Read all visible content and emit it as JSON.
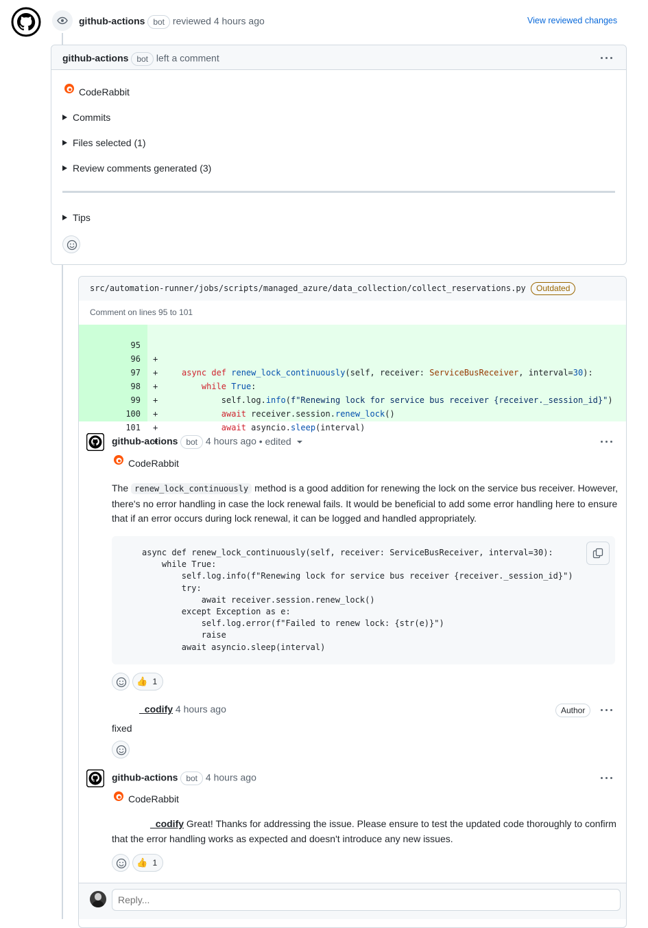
{
  "review": {
    "author": "github-actions",
    "bot_badge": "bot",
    "action": "reviewed 4 hours ago",
    "view_changes_link": "View reviewed changes"
  },
  "comment_box": {
    "author": "github-actions",
    "bot_badge": "bot",
    "action": "left a comment",
    "app_name": "CodeRabbit",
    "details": [
      {
        "label": "Commits"
      },
      {
        "label": "Files selected (1)"
      },
      {
        "label": "Review comments generated (3)"
      }
    ],
    "tips_label": "Tips"
  },
  "file_thread": {
    "path": "src/automation-runner/jobs/scripts/managed_azure/data_collection/collect_reservations.py",
    "outdated_badge": "Outdated",
    "comment_lines": "Comment on lines 95 to 101",
    "diff_lines": [
      {
        "num": "95",
        "sign": "+"
      },
      {
        "num": "96",
        "sign": "+"
      },
      {
        "num": "97",
        "sign": "+"
      },
      {
        "num": "98",
        "sign": "+"
      },
      {
        "num": "99",
        "sign": "+"
      },
      {
        "num": "100",
        "sign": "+"
      },
      {
        "num": "101",
        "sign": "+"
      }
    ],
    "diff_code": {
      "l95_kw1": "async def ",
      "l95_fn": "renew_lock_continuously",
      "l95_a": "(self, receiver: ",
      "l95_ty": "ServiceBusReceiver",
      "l95_b": ", interval=",
      "l95_num": "30",
      "l95_c": "):",
      "l96_kw": "while ",
      "l96_true": "True",
      "l96_c": ":",
      "l97_a": "self.log.",
      "l97_fn": "info",
      "l97_b": "(",
      "l97_st": "f\"Renewing lock for service bus receiver {receiver._session_id}\"",
      "l97_c": ")",
      "l98_kw": "await ",
      "l98_a": "receiver.session.",
      "l98_fn": "renew_lock",
      "l98_c": "()",
      "l99_kw": "await ",
      "l99_a": "asyncio.",
      "l99_fn": "sleep",
      "l99_c": "(interval)"
    }
  },
  "thread_comments": [
    {
      "author": "github-actions",
      "bot_badge": "bot",
      "time": "4 hours ago",
      "edited": "• edited",
      "app_name": "CodeRabbit",
      "text_pre": "The ",
      "inline_code": "renew_lock_continuously",
      "text_post": " method is a good addition for renewing the lock on the service bus receiver. However, there's no error handling in case the lock renewal fails. It would be beneficial to add some error handling here to ensure that if an error occurs during lock renewal, it can be logged and handled appropriately.",
      "code_block": "async def renew_lock_continuously(self, receiver: ServiceBusReceiver, interval=30):\n    while True:\n        self.log.info(f\"Renewing lock for service bus receiver {receiver._session_id}\")\n        try:\n            await receiver.session.renew_lock()\n        except Exception as e:\n            self.log.error(f\"Failed to renew lock: {str(e)}\")\n            raise\n        await asyncio.sleep(interval)",
      "reaction_emoji": "👍",
      "reaction_count": "1"
    },
    {
      "author": "_codify",
      "time": "4 hours ago",
      "author_badge": "Author",
      "text": "fixed"
    },
    {
      "author": "github-actions",
      "bot_badge": "bot",
      "time": "4 hours ago",
      "app_name": "CodeRabbit",
      "mention": "_codify",
      "text": " Great! Thanks for addressing the issue. Please ensure to test the updated code thoroughly to confirm that the error handling works as expected and doesn't introduce any new issues.",
      "reaction_emoji": "👍",
      "reaction_count": "1"
    }
  ],
  "reply": {
    "placeholder": "Reply..."
  }
}
